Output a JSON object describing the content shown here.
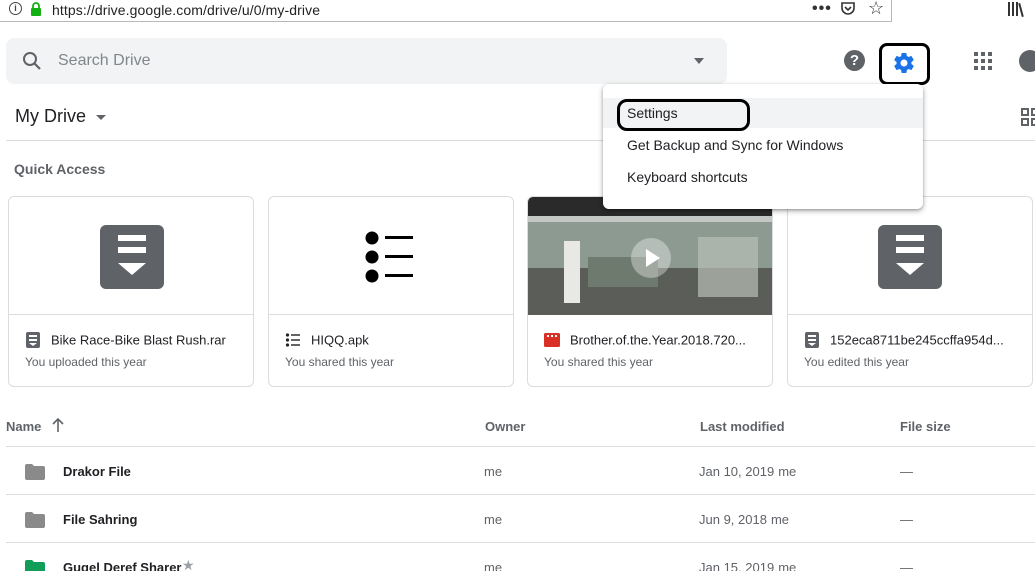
{
  "browser": {
    "url": "https://drive.google.com/drive/u/0/my-drive",
    "info_glyph": "i",
    "more_glyph": "•••",
    "star_glyph": "☆"
  },
  "search": {
    "placeholder": "Search Drive"
  },
  "header": {
    "help_glyph": "?",
    "title": "My Drive"
  },
  "quick_access": {
    "title": "Quick Access",
    "cards": [
      {
        "name": "Bike Race-Bike Blast Rush.rar",
        "subtitle": "You uploaded this year",
        "type": "archive"
      },
      {
        "name": "HIQQ.apk",
        "subtitle": "You shared this year",
        "type": "list"
      },
      {
        "name": "Brother.of.the.Year.2018.720...",
        "subtitle": "You shared this year",
        "type": "video"
      },
      {
        "name": "152eca8711be245ccffa954d...",
        "subtitle": "You edited this year",
        "type": "archive"
      }
    ]
  },
  "table": {
    "columns": {
      "name": "Name",
      "owner": "Owner",
      "modified": "Last modified",
      "size": "File size"
    },
    "rows": [
      {
        "name": "Drakor File",
        "owner": "me",
        "date": "Jan 10, 2019",
        "by": "me",
        "size": "—",
        "color": "#8a8a8a"
      },
      {
        "name": "File Sahring",
        "owner": "me",
        "date": "Jun 9, 2018",
        "by": "me",
        "size": "—",
        "color": "#8a8a8a"
      },
      {
        "name": "Gugel Deref Sharer",
        "owner": "me",
        "date": "Jan 15, 2019",
        "by": "me",
        "size": "—",
        "color": "#0f9d58",
        "starred": "★"
      }
    ]
  },
  "settings_menu": {
    "items": [
      "Settings",
      "Get Backup and Sync for Windows",
      "Keyboard shortcuts"
    ]
  },
  "colors": {
    "accent": "#1a73e8",
    "video_red": "#d93025"
  }
}
